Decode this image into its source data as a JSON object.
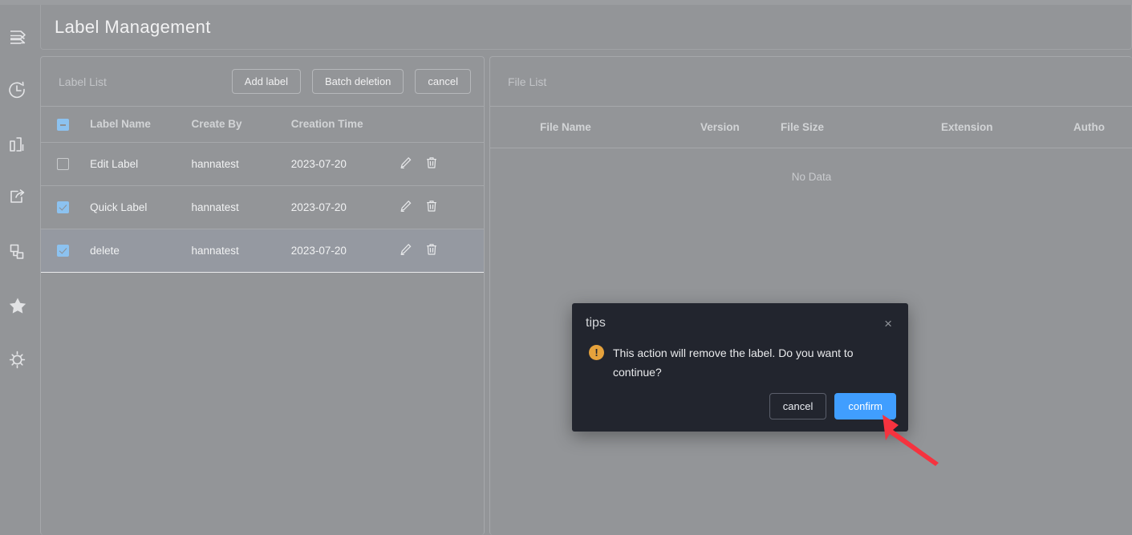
{
  "header": {
    "title": "Label Management"
  },
  "sidebar": {
    "items": [
      {
        "icon": "layers-icon",
        "name": "sidebar-item-layers"
      },
      {
        "icon": "history-icon",
        "name": "sidebar-item-history"
      },
      {
        "icon": "bar-chart-icon",
        "name": "sidebar-item-statistics"
      },
      {
        "icon": "share-icon",
        "name": "sidebar-item-share"
      },
      {
        "icon": "hierarchy-icon",
        "name": "sidebar-item-structure"
      },
      {
        "icon": "star-icon",
        "name": "sidebar-item-favorites"
      },
      {
        "icon": "gear-icon",
        "name": "sidebar-item-settings"
      }
    ]
  },
  "label_panel": {
    "title": "Label List",
    "buttons": {
      "add": "Add label",
      "batch_delete": "Batch deletion",
      "cancel": "cancel"
    },
    "columns": [
      "Label Name",
      "Create By",
      "Creation Time"
    ],
    "select_all_state": "indeterminate",
    "rows": [
      {
        "checked": false,
        "name": "Edit Label",
        "create_by": "hannatest",
        "creation_time": "2023-07-20",
        "active": false
      },
      {
        "checked": true,
        "name": "Quick Label",
        "create_by": "hannatest",
        "creation_time": "2023-07-20",
        "active": false
      },
      {
        "checked": true,
        "name": "delete",
        "create_by": "hannatest",
        "creation_time": "2023-07-20",
        "active": true
      }
    ],
    "row_actions": {
      "edit": "edit-icon",
      "delete": "trash-icon"
    }
  },
  "file_panel": {
    "title": "File List",
    "columns": [
      "File Name",
      "Version",
      "File Size",
      "Extension",
      "Autho"
    ],
    "empty_text": "No Data"
  },
  "dialog": {
    "title": "tips",
    "close": "×",
    "message": "This action will remove the label. Do you want to continue?",
    "warning_icon": "!",
    "cancel_label": "cancel",
    "confirm_label": "confirm"
  },
  "colors": {
    "page_background": "#939598",
    "dialog_background": "#22252e",
    "primary": "#409eff",
    "warning": "#e6a23c",
    "checkbox": "#8cc2f0",
    "annotation_arrow": "#f5333f"
  }
}
